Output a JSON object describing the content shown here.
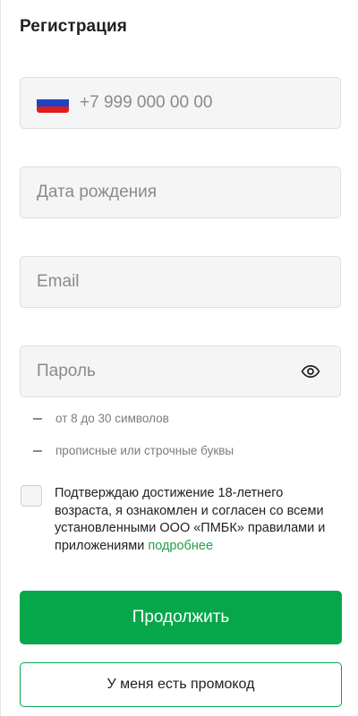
{
  "header": {
    "title": "Регистрация"
  },
  "form": {
    "phone": {
      "placeholder": "+7 999 000 00 00",
      "country_flag": "russia-flag-icon"
    },
    "birth_date": {
      "placeholder": "Дата рождения"
    },
    "email": {
      "placeholder": "Email"
    },
    "password": {
      "placeholder": "Пароль",
      "toggle_icon": "eye-icon"
    },
    "password_rules": [
      "от 8 до 30 символов",
      "прописные или строчные буквы"
    ],
    "agreement": {
      "text": "Подтверждаю достижение 18-летнего возраста, я ознакомлен и согласен со всеми установленными ООО «ПМБК» правилами и приложениями",
      "link_text": "подробнее",
      "checked": false
    }
  },
  "actions": {
    "continue_label": "Продолжить",
    "promo_label": "У меня есть промокод"
  },
  "colors": {
    "accent": "#06a74a",
    "link": "#20a14a",
    "field_bg": "#f5f5f5",
    "placeholder": "#8a8a8a"
  }
}
